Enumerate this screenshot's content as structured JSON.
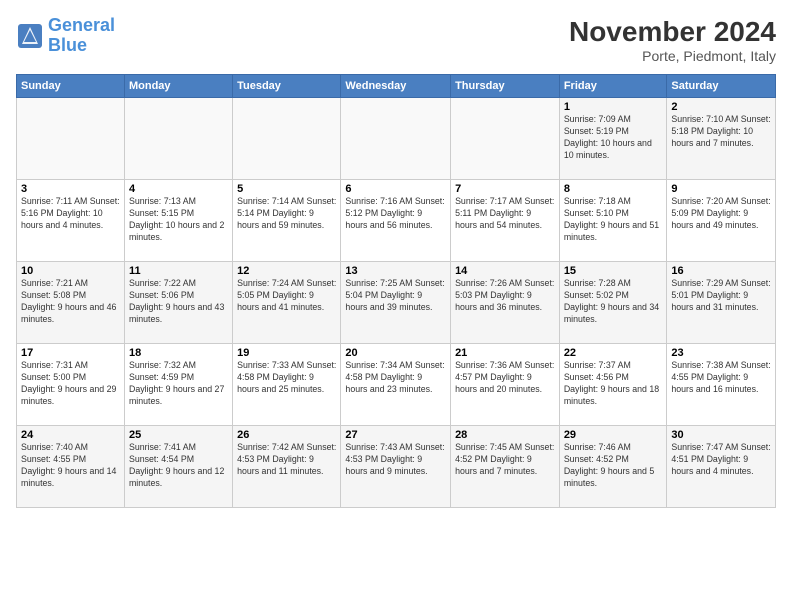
{
  "logo": {
    "line1": "General",
    "line2": "Blue"
  },
  "title": "November 2024",
  "subtitle": "Porte, Piedmont, Italy",
  "weekdays": [
    "Sunday",
    "Monday",
    "Tuesday",
    "Wednesday",
    "Thursday",
    "Friday",
    "Saturday"
  ],
  "weeks": [
    [
      {
        "day": "",
        "info": ""
      },
      {
        "day": "",
        "info": ""
      },
      {
        "day": "",
        "info": ""
      },
      {
        "day": "",
        "info": ""
      },
      {
        "day": "",
        "info": ""
      },
      {
        "day": "1",
        "info": "Sunrise: 7:09 AM\nSunset: 5:19 PM\nDaylight: 10 hours and 10 minutes."
      },
      {
        "day": "2",
        "info": "Sunrise: 7:10 AM\nSunset: 5:18 PM\nDaylight: 10 hours and 7 minutes."
      }
    ],
    [
      {
        "day": "3",
        "info": "Sunrise: 7:11 AM\nSunset: 5:16 PM\nDaylight: 10 hours and 4 minutes."
      },
      {
        "day": "4",
        "info": "Sunrise: 7:13 AM\nSunset: 5:15 PM\nDaylight: 10 hours and 2 minutes."
      },
      {
        "day": "5",
        "info": "Sunrise: 7:14 AM\nSunset: 5:14 PM\nDaylight: 9 hours and 59 minutes."
      },
      {
        "day": "6",
        "info": "Sunrise: 7:16 AM\nSunset: 5:12 PM\nDaylight: 9 hours and 56 minutes."
      },
      {
        "day": "7",
        "info": "Sunrise: 7:17 AM\nSunset: 5:11 PM\nDaylight: 9 hours and 54 minutes."
      },
      {
        "day": "8",
        "info": "Sunrise: 7:18 AM\nSunset: 5:10 PM\nDaylight: 9 hours and 51 minutes."
      },
      {
        "day": "9",
        "info": "Sunrise: 7:20 AM\nSunset: 5:09 PM\nDaylight: 9 hours and 49 minutes."
      }
    ],
    [
      {
        "day": "10",
        "info": "Sunrise: 7:21 AM\nSunset: 5:08 PM\nDaylight: 9 hours and 46 minutes."
      },
      {
        "day": "11",
        "info": "Sunrise: 7:22 AM\nSunset: 5:06 PM\nDaylight: 9 hours and 43 minutes."
      },
      {
        "day": "12",
        "info": "Sunrise: 7:24 AM\nSunset: 5:05 PM\nDaylight: 9 hours and 41 minutes."
      },
      {
        "day": "13",
        "info": "Sunrise: 7:25 AM\nSunset: 5:04 PM\nDaylight: 9 hours and 39 minutes."
      },
      {
        "day": "14",
        "info": "Sunrise: 7:26 AM\nSunset: 5:03 PM\nDaylight: 9 hours and 36 minutes."
      },
      {
        "day": "15",
        "info": "Sunrise: 7:28 AM\nSunset: 5:02 PM\nDaylight: 9 hours and 34 minutes."
      },
      {
        "day": "16",
        "info": "Sunrise: 7:29 AM\nSunset: 5:01 PM\nDaylight: 9 hours and 31 minutes."
      }
    ],
    [
      {
        "day": "17",
        "info": "Sunrise: 7:31 AM\nSunset: 5:00 PM\nDaylight: 9 hours and 29 minutes."
      },
      {
        "day": "18",
        "info": "Sunrise: 7:32 AM\nSunset: 4:59 PM\nDaylight: 9 hours and 27 minutes."
      },
      {
        "day": "19",
        "info": "Sunrise: 7:33 AM\nSunset: 4:58 PM\nDaylight: 9 hours and 25 minutes."
      },
      {
        "day": "20",
        "info": "Sunrise: 7:34 AM\nSunset: 4:58 PM\nDaylight: 9 hours and 23 minutes."
      },
      {
        "day": "21",
        "info": "Sunrise: 7:36 AM\nSunset: 4:57 PM\nDaylight: 9 hours and 20 minutes."
      },
      {
        "day": "22",
        "info": "Sunrise: 7:37 AM\nSunset: 4:56 PM\nDaylight: 9 hours and 18 minutes."
      },
      {
        "day": "23",
        "info": "Sunrise: 7:38 AM\nSunset: 4:55 PM\nDaylight: 9 hours and 16 minutes."
      }
    ],
    [
      {
        "day": "24",
        "info": "Sunrise: 7:40 AM\nSunset: 4:55 PM\nDaylight: 9 hours and 14 minutes."
      },
      {
        "day": "25",
        "info": "Sunrise: 7:41 AM\nSunset: 4:54 PM\nDaylight: 9 hours and 12 minutes."
      },
      {
        "day": "26",
        "info": "Sunrise: 7:42 AM\nSunset: 4:53 PM\nDaylight: 9 hours and 11 minutes."
      },
      {
        "day": "27",
        "info": "Sunrise: 7:43 AM\nSunset: 4:53 PM\nDaylight: 9 hours and 9 minutes."
      },
      {
        "day": "28",
        "info": "Sunrise: 7:45 AM\nSunset: 4:52 PM\nDaylight: 9 hours and 7 minutes."
      },
      {
        "day": "29",
        "info": "Sunrise: 7:46 AM\nSunset: 4:52 PM\nDaylight: 9 hours and 5 minutes."
      },
      {
        "day": "30",
        "info": "Sunrise: 7:47 AM\nSunset: 4:51 PM\nDaylight: 9 hours and 4 minutes."
      }
    ]
  ]
}
